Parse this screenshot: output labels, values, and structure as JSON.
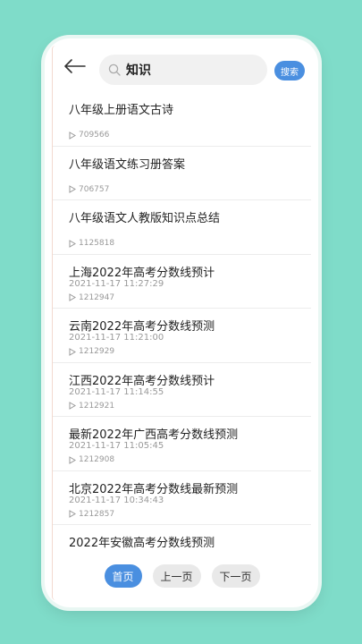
{
  "search": {
    "query": "知识",
    "button_label": "搜索"
  },
  "results": [
    {
      "title": "八年级上册语文古诗",
      "date": "",
      "views": "709566"
    },
    {
      "title": "八年级语文练习册答案",
      "date": "",
      "views": "706757"
    },
    {
      "title": "八年级语文人教版知识点总结",
      "date": "",
      "views": "1125818"
    },
    {
      "title": "上海2022年高考分数线预计",
      "date": "2021-11-17 11:27:29",
      "views": "1212947"
    },
    {
      "title": "云南2022年高考分数线预测",
      "date": "2021-11-17 11:21:00",
      "views": "1212929"
    },
    {
      "title": "江西2022年高考分数线预计",
      "date": "2021-11-17 11:14:55",
      "views": "1212921"
    },
    {
      "title": "最新2022年广西高考分数线预测",
      "date": "2021-11-17 11:05:45",
      "views": "1212908"
    },
    {
      "title": "北京2022年高考分数线最新预测",
      "date": "2021-11-17 10:34:43",
      "views": "1212857"
    },
    {
      "title": "2022年安徽高考分数线预测",
      "date": "",
      "views": ""
    }
  ],
  "pager": {
    "home": "首页",
    "prev": "上一页",
    "next": "下一页"
  },
  "colors": {
    "background": "#7fdcc9",
    "accent": "#4a8fe0"
  }
}
